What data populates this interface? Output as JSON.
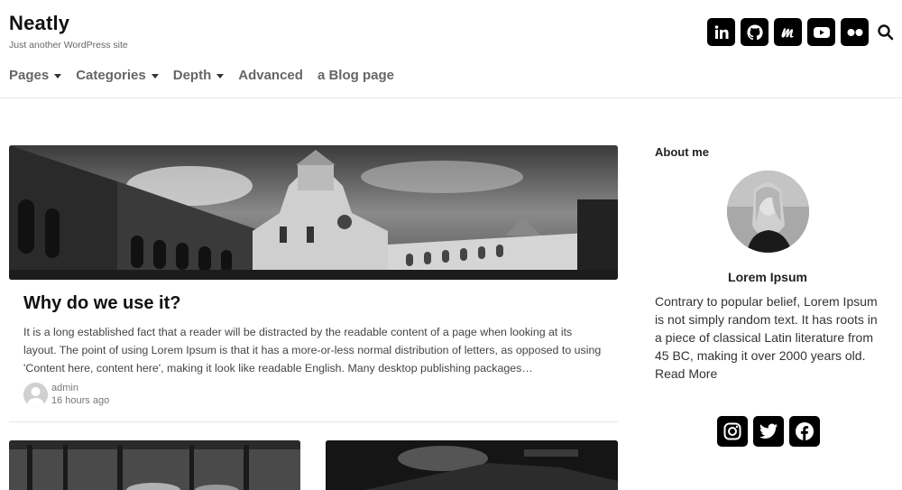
{
  "site": {
    "title": "Neatly",
    "tagline": "Just another WordPress site"
  },
  "header_social": [
    {
      "icon": "linkedin-icon"
    },
    {
      "icon": "github-icon"
    },
    {
      "icon": "meetup-icon"
    },
    {
      "icon": "youtube-icon"
    },
    {
      "icon": "flickr-icon"
    }
  ],
  "nav": {
    "items": [
      {
        "label": "Pages",
        "has_dropdown": true
      },
      {
        "label": "Categories",
        "has_dropdown": true
      },
      {
        "label": "Depth",
        "has_dropdown": true
      },
      {
        "label": "Advanced",
        "has_dropdown": false
      },
      {
        "label": "a Blog page",
        "has_dropdown": false
      }
    ]
  },
  "post": {
    "title": "Why do we use it?",
    "excerpt": "It is a long established fact that a reader will be distracted by the readable content of a page when looking at its layout. The point of using Lorem Ipsum is that it has a more-or-less normal distribution of letters, as opposed to using 'Content here, content here', making it look like readable English. Many desktop publishing packages…",
    "author": "admin",
    "time": "16 hours ago"
  },
  "sidebar": {
    "widget_title": "About me",
    "name": "Lorem Ipsum",
    "bio": "Contrary to popular belief, Lorem Ipsum is not simply random text. It has roots in a piece of classical Latin literature from 45 BC, making it over 2000 years old.",
    "read_more": "Read More",
    "social": [
      {
        "icon": "instagram-icon"
      },
      {
        "icon": "twitter-icon"
      },
      {
        "icon": "facebook-icon"
      }
    ]
  },
  "colors": {
    "text": "#222222",
    "nav_text": "#666666",
    "icon_bg": "#000000",
    "divider": "#e6e6e6"
  }
}
